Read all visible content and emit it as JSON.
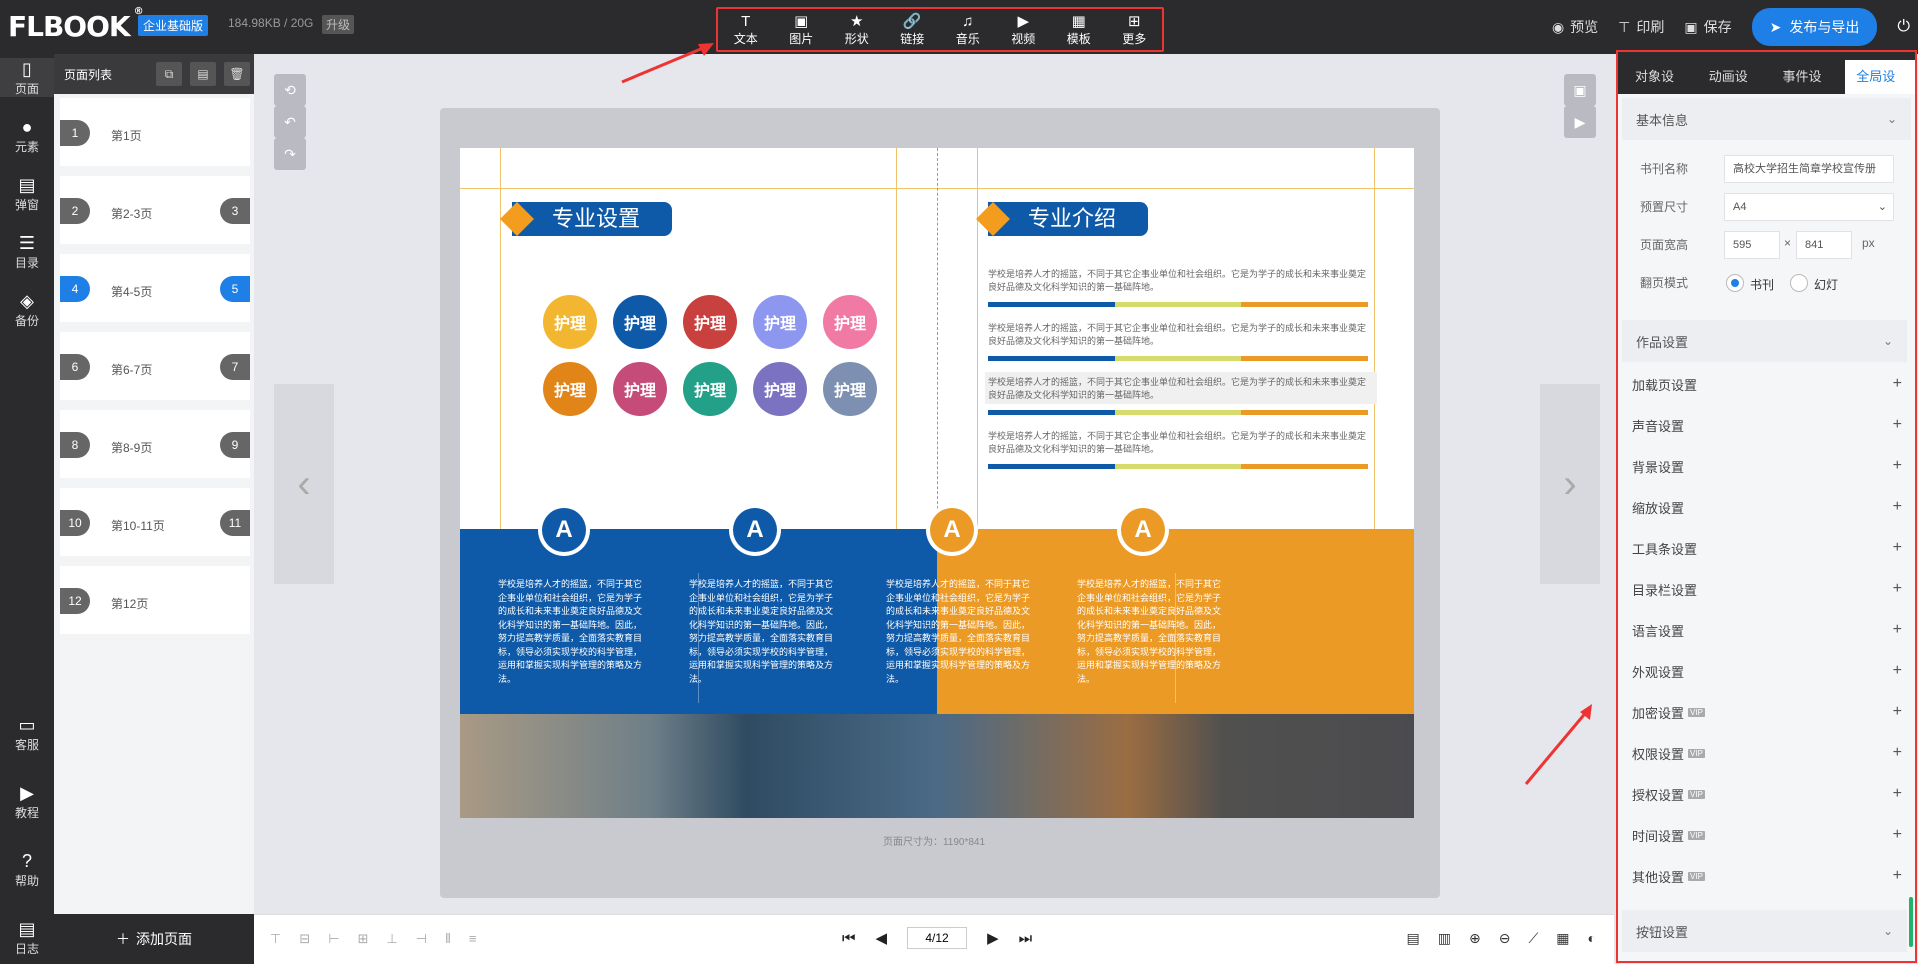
{
  "header": {
    "logo": "FLBOOK",
    "logo_mark": "®",
    "edition": "企业基础版",
    "storage": "184.98KB / 20G",
    "upgrade": "升级",
    "tools": [
      {
        "label": "文本",
        "icon": "T"
      },
      {
        "label": "图片",
        "icon": "▣"
      },
      {
        "label": "形状",
        "icon": "★"
      },
      {
        "label": "链接",
        "icon": "🔗"
      },
      {
        "label": "音乐",
        "icon": "♫"
      },
      {
        "label": "视频",
        "icon": "▶"
      },
      {
        "label": "模板",
        "icon": "▦"
      },
      {
        "label": "更多",
        "icon": "⊞"
      }
    ],
    "preview": "预览",
    "print": "印刷",
    "save": "保存",
    "publish": "发布与导出"
  },
  "leftnav": {
    "items": [
      {
        "label": "页面",
        "icon": "▯"
      },
      {
        "label": "元素",
        "icon": "●"
      },
      {
        "label": "弹窗",
        "icon": "▤"
      },
      {
        "label": "目录",
        "icon": "☰"
      },
      {
        "label": "备份",
        "icon": "◈"
      }
    ],
    "bottom": [
      {
        "label": "客服",
        "icon": "▭"
      },
      {
        "label": "教程",
        "icon": "▶"
      },
      {
        "label": "帮助",
        "icon": "?"
      },
      {
        "label": "日志",
        "icon": "▤"
      }
    ]
  },
  "pagelist": {
    "title": "页面列表",
    "pages": [
      {
        "num": "1",
        "num2": "",
        "label": "第1页"
      },
      {
        "num": "2",
        "num2": "3",
        "label": "第2-3页"
      },
      {
        "num": "4",
        "num2": "5",
        "label": "第4-5页"
      },
      {
        "num": "6",
        "num2": "7",
        "label": "第6-7页"
      },
      {
        "num": "8",
        "num2": "9",
        "label": "第8-9页"
      },
      {
        "num": "10",
        "num2": "11",
        "label": "第10-11页"
      },
      {
        "num": "12",
        "num2": "",
        "label": "第12页"
      }
    ],
    "add": "添加页面"
  },
  "book": {
    "left_title": "专业设置",
    "right_title": "专业介绍",
    "circle_label": "护理",
    "circle_colors": [
      "#f3b630",
      "#0f5aa8",
      "#c8413f",
      "#8e97ef",
      "#f07aa4",
      "#e28519",
      "#c54c79",
      "#22a088",
      "#7b73c2",
      "#7e90b2"
    ],
    "para": "学校是培养人才的摇篮，不同于其它企事业单位和社会组织。它是为学子的成长和未来事业奠定良好品德及文化科学知识的第一基础阵地。",
    "band_letter": "A",
    "band_text": "学校是培养人才的摇篮，不同于其它企事业单位和社会组织，它是为学子的成长和未来事业奠定良好品德及文化科学知识的第一基础阵地。因此，努力提高教学质量，全面落实教育目标，领导必须实现学校的科学管理，运用和掌握实现科学管理的策略及方法。",
    "page_size": "页面尺寸为：1190*841"
  },
  "bottombar": {
    "page_indicator": "4/12"
  },
  "rpanel": {
    "tabs": [
      "对象设置",
      "动画设置",
      "事件设置",
      "全局设置"
    ],
    "basic": "基本信息",
    "book_name_label": "书刊名称",
    "book_name": "高校大学招生简章学校宣传册",
    "preset_label": "预置尺寸",
    "preset": "A4",
    "wh_label": "页面宽高",
    "width": "595",
    "height": "841",
    "unit": "px",
    "times": "×",
    "flip_label": "翻页模式",
    "flip_book": "书刊",
    "flip_slide": "幻灯",
    "works": "作品设置",
    "rows": [
      {
        "label": "加载页设置",
        "vip": ""
      },
      {
        "label": "声音设置",
        "vip": ""
      },
      {
        "label": "背景设置",
        "vip": ""
      },
      {
        "label": "缩放设置",
        "vip": ""
      },
      {
        "label": "工具条设置",
        "vip": ""
      },
      {
        "label": "目录栏设置",
        "vip": ""
      },
      {
        "label": "语言设置",
        "vip": ""
      },
      {
        "label": "外观设置",
        "vip": ""
      },
      {
        "label": "加密设置",
        "vip": "VIP"
      },
      {
        "label": "权限设置",
        "vip": "VIP"
      },
      {
        "label": "授权设置",
        "vip": "VIP"
      },
      {
        "label": "时间设置",
        "vip": "VIP"
      },
      {
        "label": "其他设置",
        "vip": "VIP"
      }
    ],
    "buttons": "按钮设置"
  }
}
